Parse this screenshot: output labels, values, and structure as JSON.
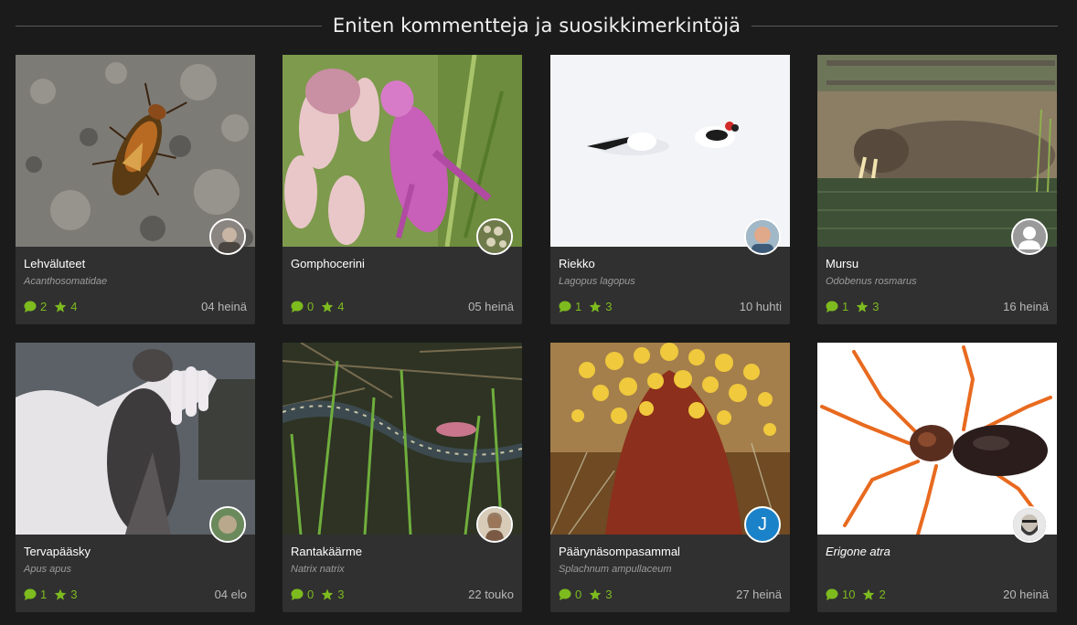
{
  "section_title": "Eniten kommentteja ja suosikkimerkintöjä",
  "colors": {
    "accent": "#7dbb1f",
    "card_bg": "#303030",
    "page_bg": "#1b1b1b"
  },
  "cards": [
    {
      "title": "Lehväluteet",
      "scientific": "Acanthosomatidae",
      "comments": "2",
      "favorites": "4",
      "date": "04 heinä",
      "photo": "shield-bug-on-rock",
      "avatar": "user-photo"
    },
    {
      "title": "Gomphocerini",
      "scientific": "",
      "comments": "0",
      "favorites": "4",
      "date": "05 heinä",
      "photo": "pink-grasshopper-on-clover",
      "avatar": "user-photo"
    },
    {
      "title": "Riekko",
      "scientific": "Lagopus lagopus",
      "comments": "1",
      "favorites": "3",
      "date": "10 huhti",
      "photo": "willow-ptarmigan-in-snow",
      "avatar": "user-photo"
    },
    {
      "title": "Mursu",
      "scientific": "Odobenus rosmarus",
      "comments": "1",
      "favorites": "3",
      "date": "16 heinä",
      "photo": "walrus-in-water",
      "avatar": "default-user"
    },
    {
      "title": "Tervapääsky",
      "scientific": "Apus apus",
      "comments": "1",
      "favorites": "3",
      "date": "04 elo",
      "photo": "swift-in-gloved-hand",
      "avatar": "user-photo"
    },
    {
      "title": "Rantakäärme",
      "scientific": "Natrix natrix",
      "comments": "0",
      "favorites": "3",
      "date": "22 touko",
      "photo": "grass-snake-in-reeds",
      "avatar": "user-photo"
    },
    {
      "title": "Päärynäsompasammal",
      "scientific": "Splachnum ampullaceum",
      "comments": "0",
      "favorites": "3",
      "date": "27 heinä",
      "photo": "moss-sporophytes",
      "avatar": "letter",
      "avatar_letter": "J"
    },
    {
      "title": "Erigone atra",
      "scientific": "",
      "comments": "10",
      "favorites": "2",
      "date": "20 heinä",
      "photo": "spider-on-white",
      "avatar": "user-photo"
    }
  ]
}
